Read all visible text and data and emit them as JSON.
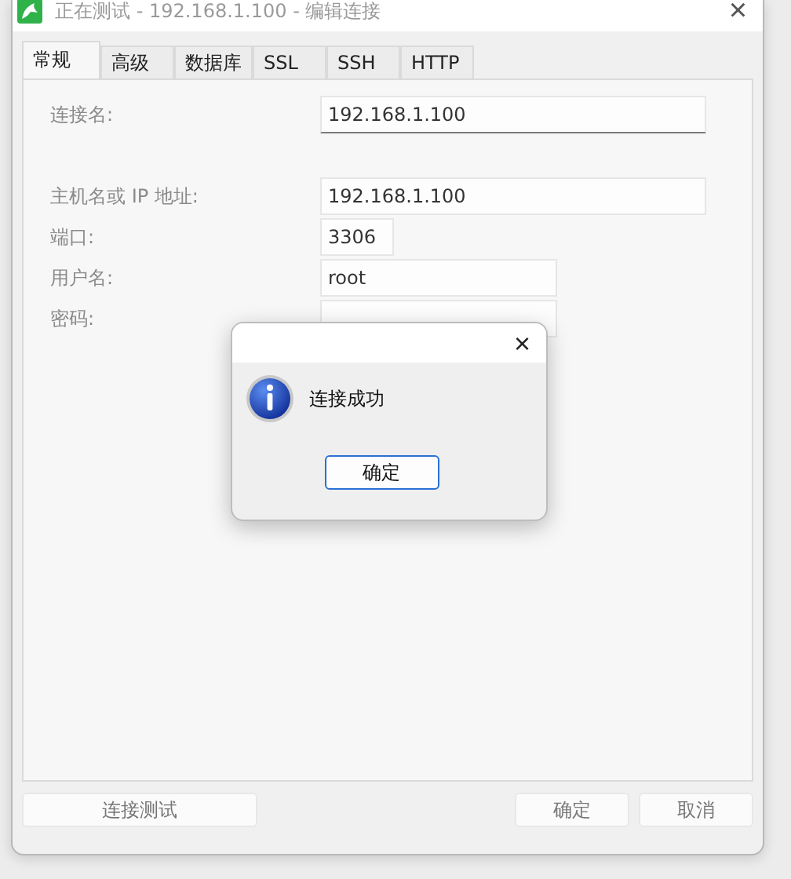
{
  "window": {
    "title": "正在测试 - 192.168.1.100 - 编辑连接",
    "close": "×"
  },
  "tabs": [
    {
      "label": "常规",
      "selected": true
    },
    {
      "label": "高级",
      "selected": false
    },
    {
      "label": "数据库",
      "selected": false
    },
    {
      "label": "SSL",
      "selected": false
    },
    {
      "label": "SSH",
      "selected": false
    },
    {
      "label": "HTTP",
      "selected": false
    }
  ],
  "fields": [
    {
      "label": "连接名:",
      "value": "192.168.1.100",
      "focused": true
    },
    {
      "label": "主机名或 IP 地址:",
      "value": "192.168.1.100",
      "focused": false
    },
    {
      "label": "端口:",
      "value": "3306",
      "focused": false
    },
    {
      "label": "用户名:",
      "value": "root",
      "focused": false
    },
    {
      "label": "密码:",
      "focused": false
    }
  ],
  "footer": {
    "test_button": "连接测试",
    "ok_button": "确定",
    "cancel_button": "取消"
  },
  "dialog": {
    "close": "×",
    "message": "连接成功",
    "button": "确定"
  }
}
